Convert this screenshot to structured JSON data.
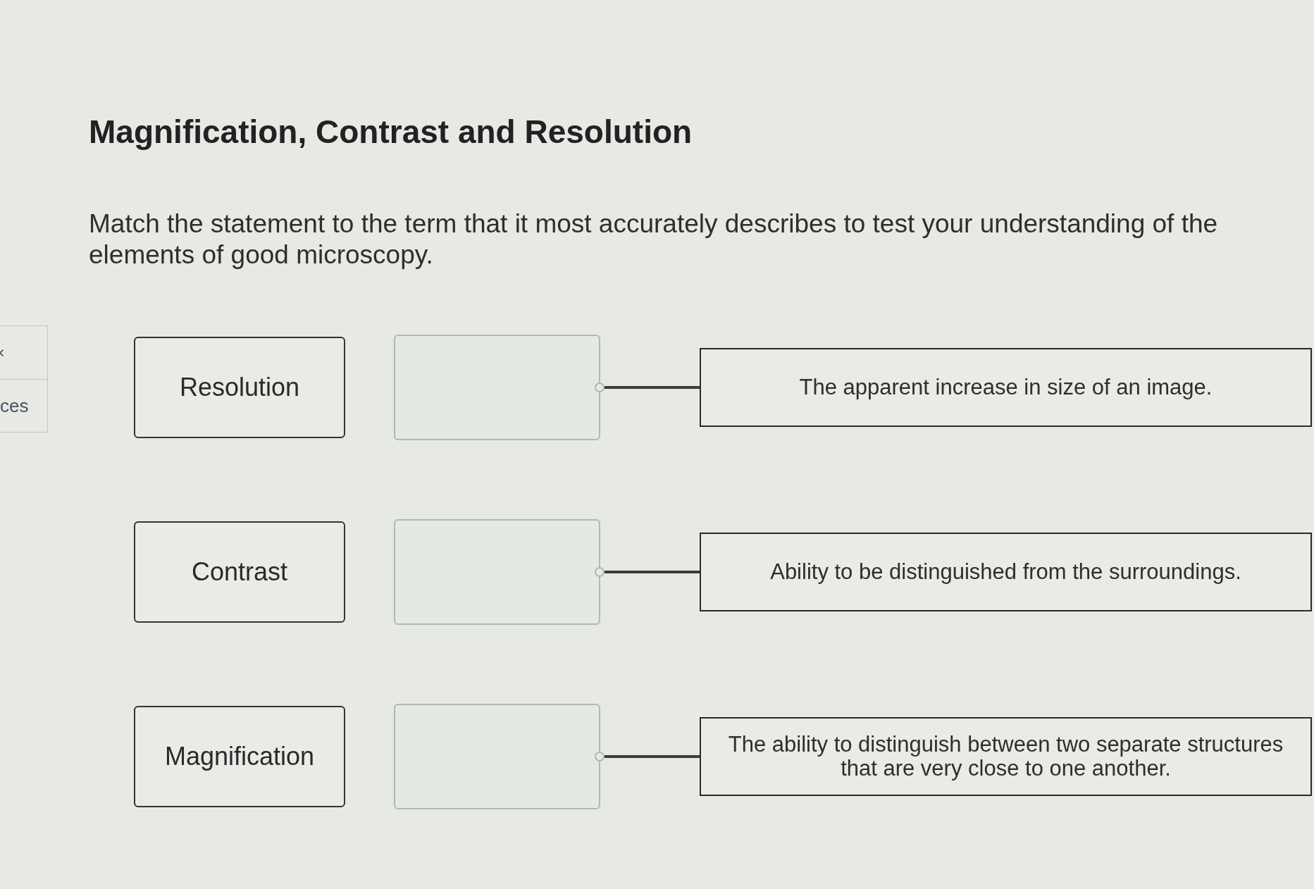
{
  "sidebar": {
    "label": "ces"
  },
  "title": "Magnification, Contrast and Resolution",
  "instructions": "Match the statement to the term that it most accurately describes to test your understanding of the elements of good microscopy.",
  "rows": [
    {
      "term": "Resolution",
      "statement": "The apparent increase in size of an image."
    },
    {
      "term": "Contrast",
      "statement": "Ability to be distinguished from the surroundings."
    },
    {
      "term": "Magnification",
      "statement": "The ability to distinguish between two separate structures that are very close to one another."
    }
  ]
}
